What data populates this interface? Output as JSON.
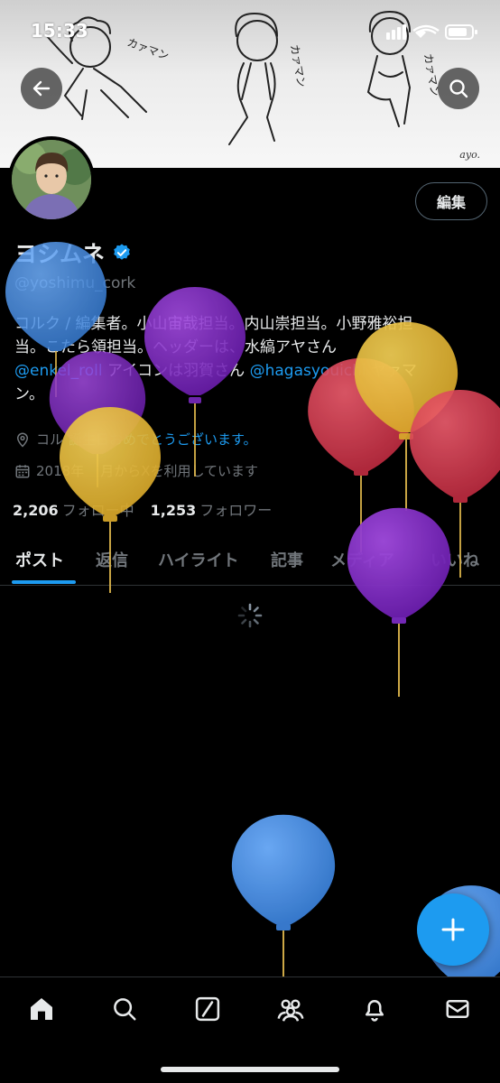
{
  "status_bar": {
    "time": "15:33"
  },
  "banner": {
    "doodle_texts": [
      "カァマン",
      "カァマン",
      "カァマン"
    ],
    "signature": "ayo."
  },
  "profile": {
    "display_name": "ヨシムネ",
    "handle": "@yoshimu_cork",
    "edit_button": "編集",
    "bio": {
      "line1_a": "コルク / 編集者。",
      "line1_b": "小山宙哉担当。",
      "line1_c": "内山崇担当。",
      "line1_d": "小野雅裕担",
      "line2_a": "当。",
      "line2_b": "こたら領担当。",
      "line2_c": "ヘッダーは、水縞アヤさん",
      "mention1": "@enkel_roll",
      "line3_b": " アイコンは羽賀さん ",
      "mention2": "@hagasyouichi",
      "line3_d": " ヤァマ",
      "line4": "ン。"
    },
    "location_prefix": "コル",
    "location_link": "誕生日おめでとうございます。",
    "joined_a": "2018年",
    "joined_b": "月からXを利用しています",
    "following_count": "2,206",
    "following_label": "フォロー中",
    "followers_count": "1,253",
    "followers_label": "フォロワー"
  },
  "tabs": [
    "ポスト",
    "返信",
    "ハイライト",
    "記事",
    "メディア",
    "いいね"
  ],
  "colors": {
    "accent": "#1d9bf0",
    "background": "#000000",
    "muted": "#71767b",
    "divider": "#2f3336"
  },
  "icons": [
    "back-arrow-icon",
    "search-icon",
    "verified-badge-icon",
    "location-icon",
    "calendar-icon",
    "loading-spinner-icon",
    "plus-icon",
    "home-icon",
    "search-icon",
    "grok-icon",
    "communities-icon",
    "notifications-icon",
    "messages-icon"
  ]
}
